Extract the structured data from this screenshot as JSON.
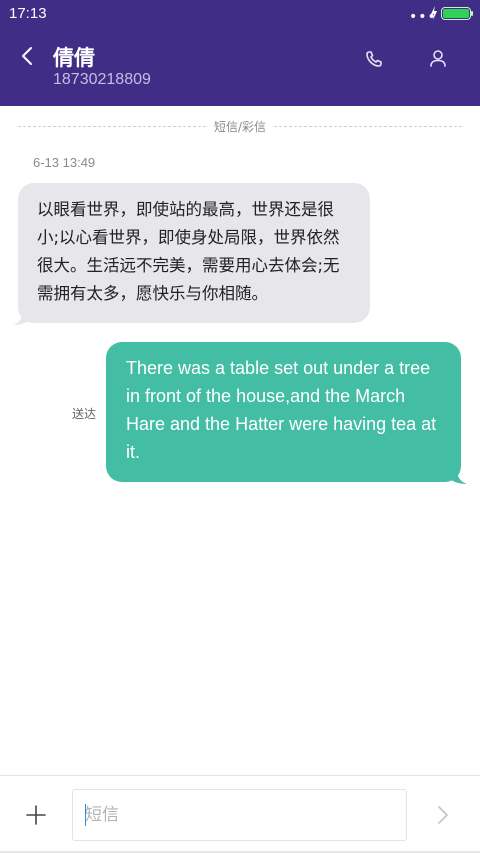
{
  "status_bar": {
    "time": "17:13",
    "signal_dots": "•••",
    "battery_percent": 100,
    "battery_color": "#34d158"
  },
  "header": {
    "contact_name": "倩倩",
    "contact_number": "18730218809",
    "background_color": "#3f2d86",
    "back_icon": "chevron-left-icon",
    "call_icon": "phone-icon",
    "contact_icon": "person-icon"
  },
  "conversation": {
    "divider_label": "短信/彩信",
    "timestamp": "6-13 13:49",
    "messages": [
      {
        "direction": "incoming",
        "lines": [
          "以眼看世界，即使站的最高，世界还是很",
          "小;以心看世界，即使身处局限，世界依然",
          "很大。生活远不完美，需要用心去体会;无",
          "需拥有太多，愿快乐与你相随。"
        ],
        "bubble_color": "#e6e6eb"
      },
      {
        "direction": "outgoing",
        "lines": [
          "There was a table set out under a tree",
          "in front of the house,and the March",
          "Hare and the Hatter were having tea at",
          "it."
        ],
        "status": "送达",
        "bubble_color": "#43bea4"
      }
    ]
  },
  "composer": {
    "placeholder": "短信",
    "value": "",
    "add_icon": "plus-icon",
    "send_icon": "chevron-right-icon"
  }
}
